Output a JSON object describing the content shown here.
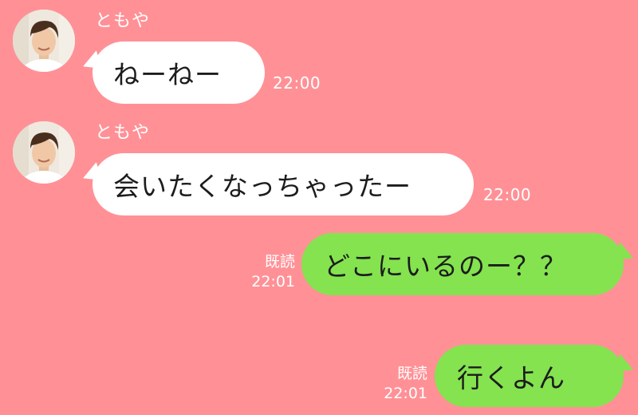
{
  "colors": {
    "background": "#ff9196",
    "incoming_bubble": "#ffffff",
    "outgoing_bubble": "#84e34f",
    "meta_text": "#ffffff"
  },
  "messages": [
    {
      "direction": "incoming",
      "sender": "ともや",
      "text": "ねーねー",
      "time": "22:00",
      "avatar": "user-avatar"
    },
    {
      "direction": "incoming",
      "sender": "ともや",
      "text": "会いたくなっちゃったー",
      "time": "22:00",
      "avatar": "user-avatar"
    },
    {
      "direction": "outgoing",
      "read": "既読",
      "text": "どこにいるのー？？",
      "time": "22:01"
    },
    {
      "direction": "outgoing",
      "read": "既読",
      "text": "行くよん",
      "time": "22:01"
    }
  ]
}
